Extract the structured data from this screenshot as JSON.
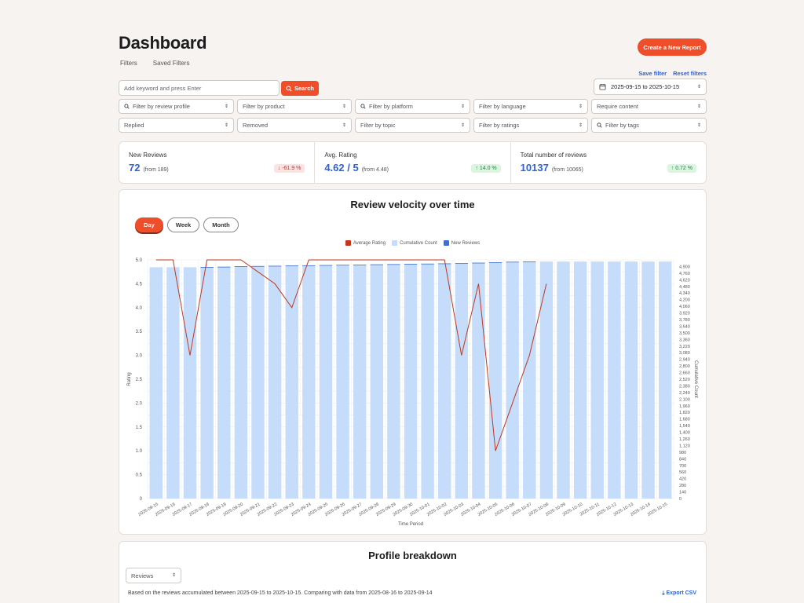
{
  "header": {
    "title": "Dashboard",
    "tabs": [
      "Filters",
      "Saved Filters"
    ],
    "create_label": "Create a New Report",
    "save_filter": "Save filter",
    "reset_filters": "Reset filters"
  },
  "search": {
    "placeholder": "Add keyword and press Enter",
    "button": "Search"
  },
  "date_range": "2025-09-15 to 2025-10-15",
  "filters": {
    "review_profile": "Filter by review profile",
    "product": "Filter by product",
    "platform": "Filter by platform",
    "language": "Filter by language",
    "require_content": "Require content",
    "replied": "Replied",
    "removed": "Removed",
    "topic": "Filter by topic",
    "ratings": "Filter by ratings",
    "tags": "Filter by tags"
  },
  "stats": [
    {
      "label": "New Reviews",
      "value": "72",
      "from": "(from 189)",
      "change": "-61.9 %",
      "direction": "down"
    },
    {
      "label": "Avg. Rating",
      "value": "4.62 / 5",
      "from": "(from 4.48)",
      "change": "14.0 %",
      "direction": "up"
    },
    {
      "label": "Total number of reviews",
      "value": "10137",
      "from": "(from 10065)",
      "change": "0.72 %",
      "direction": "up"
    }
  ],
  "chart_section": {
    "title": "Review velocity over time",
    "periods": [
      "Day",
      "Week",
      "Month"
    ],
    "active_period": "Day"
  },
  "chart_data": {
    "type": "bar",
    "categories": [
      "2025-09-15",
      "2025-09-16",
      "2025-09-17",
      "2025-09-18",
      "2025-09-19",
      "2025-09-20",
      "2025-09-21",
      "2025-09-22",
      "2025-09-23",
      "2025-09-24",
      "2025-09-25",
      "2025-09-26",
      "2025-09-27",
      "2025-09-28",
      "2025-09-29",
      "2025-09-30",
      "2025-10-01",
      "2025-10-02",
      "2025-10-03",
      "2025-10-04",
      "2025-10-05",
      "2025-10-06",
      "2025-10-07",
      "2025-10-08",
      "2025-10-09",
      "2025-10-10",
      "2025-10-11",
      "2025-10-12",
      "2025-10-13",
      "2025-10-14",
      "2025-10-15"
    ],
    "legend": [
      "Average Rating",
      "Cumulative Count",
      "New Reviews"
    ],
    "series": [
      {
        "name": "Average Rating",
        "axis": "left",
        "type": "line",
        "color": "#c0391b",
        "values": [
          5.0,
          5.0,
          3.0,
          5.0,
          5.0,
          5.0,
          4.75,
          4.5,
          4.0,
          5.0,
          5.0,
          5.0,
          5.0,
          5.0,
          5.0,
          5.0,
          5.0,
          5.0,
          3.0,
          4.5,
          1.0,
          2.0,
          3.0,
          4.5,
          null,
          null,
          null,
          null,
          null,
          null,
          null
        ]
      },
      {
        "name": "Cumulative Count",
        "axis": "right",
        "type": "bar",
        "color": "#c5dcfb",
        "values": [
          4885,
          4885,
          4885,
          4890,
          4895,
          4905,
          4910,
          4915,
          4920,
          4925,
          4930,
          4935,
          4940,
          4945,
          4950,
          4955,
          4960,
          4965,
          4970,
          4980,
          4990,
          5000,
          5005,
          5005,
          5005,
          5005,
          5005,
          5005,
          5005,
          5005,
          5005
        ]
      },
      {
        "name": "New Reviews",
        "axis": "right",
        "type": "bar",
        "color": "#3b6fd8",
        "values": [
          0,
          0,
          0,
          5,
          5,
          10,
          5,
          5,
          5,
          5,
          5,
          5,
          5,
          5,
          5,
          5,
          5,
          5,
          5,
          10,
          10,
          10,
          5,
          0,
          0,
          0,
          0,
          0,
          0,
          0,
          0
        ]
      }
    ],
    "ylabel": "Rating",
    "ylim": [
      0,
      5
    ],
    "yticks": [
      "0",
      "0.5",
      "1.0",
      "1.5",
      "2.0",
      "2.5",
      "3.0",
      "3.5",
      "4.0",
      "4.5",
      "5.0"
    ],
    "y2label": "Cumulative Count",
    "y2lim": [
      0,
      5040
    ],
    "y2ticks": [
      "0",
      "140",
      "280",
      "420",
      "560",
      "700",
      "840",
      "980",
      "1,120",
      "1,260",
      "1,400",
      "1,540",
      "1,680",
      "1,820",
      "1,960",
      "2,100",
      "2,240",
      "2,380",
      "2,520",
      "2,660",
      "2,800",
      "2,940",
      "3,080",
      "3,220",
      "3,360",
      "3,500",
      "3,640",
      "3,780",
      "3,920",
      "4,060",
      "4,200",
      "4,340",
      "4,480",
      "4,620",
      "4,760",
      "4,900"
    ],
    "xlabel": "Time Period",
    "grid": true
  },
  "profile": {
    "title": "Profile breakdown",
    "select": "Reviews",
    "note": "Based on the reviews accumulated between 2025-09-15 to 2025-10-15. Comparing with data from 2025-08-16 to 2025-09-14",
    "export": "Export CSV"
  }
}
